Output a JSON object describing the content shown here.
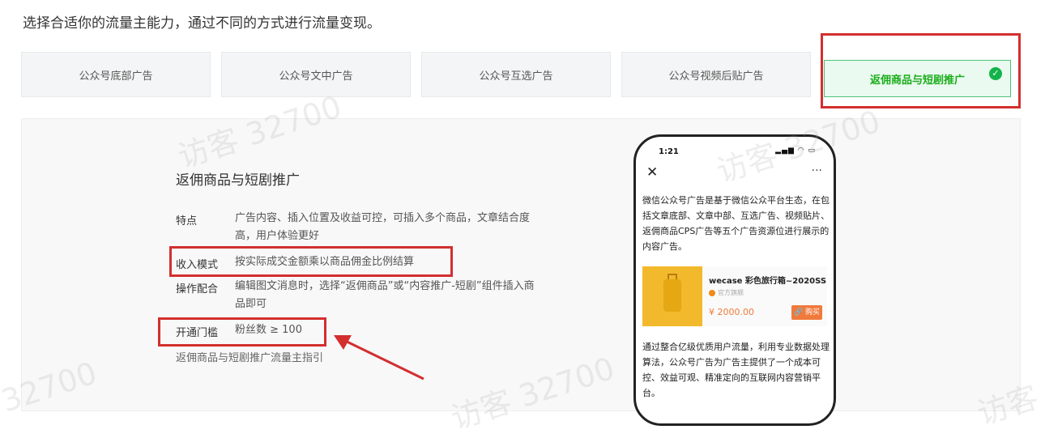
{
  "intro_text": "选择合适你的流量主能力，通过不同的方式进行流量变现。",
  "tabs": [
    {
      "label": "公众号底部广告"
    },
    {
      "label": "公众号文中广告"
    },
    {
      "label": "公众号互选广告"
    },
    {
      "label": "公众号视频后贴广告"
    },
    {
      "label": "返佣商品与短剧推广",
      "active": true
    }
  ],
  "selected_icon": "check-circle-icon",
  "panel": {
    "title": "返佣商品与短剧推广",
    "rows": [
      {
        "label": "特点",
        "value": "广告内容、插入位置及收益可控，可插入多个商品，文章结合度高，用户体验更好"
      },
      {
        "label": "收入模式",
        "value": "按实际成交金额乘以商品佣金比例结算"
      },
      {
        "label": "操作配合",
        "value": "编辑图文消息时，选择“返佣商品”或“内容推广-短剧”组件插入商品即可"
      },
      {
        "label": "开通门槛",
        "value": "粉丝数 ≥ 100"
      }
    ],
    "guide_link": "返佣商品与短剧推广流量主指引"
  },
  "phone": {
    "time": "1:21",
    "status_icons": "▂▄▆ ◠ ▭",
    "close": "✕",
    "more": "···",
    "description": "微信公众号广告是基于微信公众平台生态，在包括文章底部、文章中部、互选广告、视频贴片、返佣商品CPS广告等五个广告资源位进行展示的内容广告。",
    "product": {
      "name": "wecase 彩色旅行箱~2020SS",
      "shop": "官方旗舰",
      "price": "¥ 2000.00",
      "buy_label": "🔗 购买"
    },
    "description2": "通过整合亿级优质用户流量，利用专业数据处理算法，公众号广告为广告主提供了一个成本可控、效益可观、精准定向的互联网内容营销平台。"
  },
  "watermarks": [
    "访客 32700",
    "访客 32700",
    "32700",
    "访客 32700",
    "访客"
  ],
  "colors": {
    "highlight": "#d32f2f",
    "active_green": "#1aad19",
    "price_orange": "#f07a3c"
  }
}
